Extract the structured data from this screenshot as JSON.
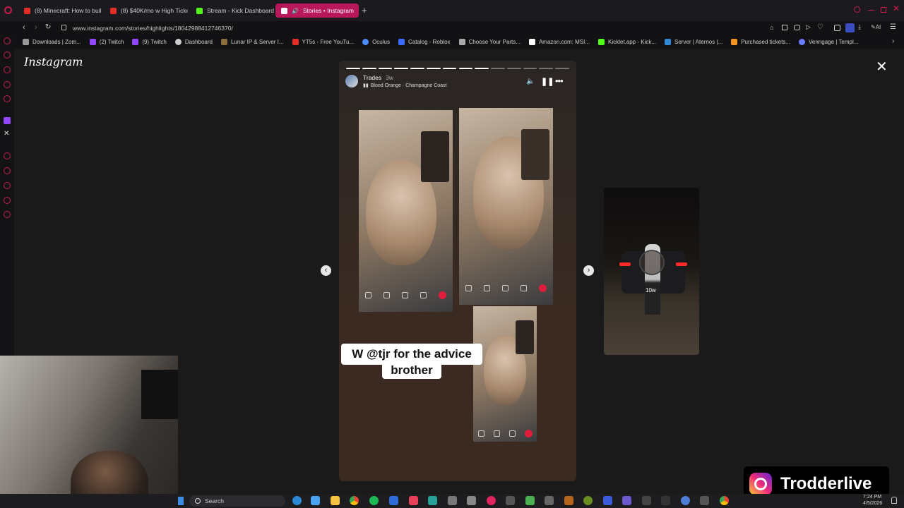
{
  "tabs": [
    {
      "label": "(8) Minecraft: How to buil...",
      "fav": "#e52d27"
    },
    {
      "label": "(8) $40K/mo w High Ticke...",
      "fav": "#e52d27"
    },
    {
      "label": "Stream - Kick Dashboard",
      "fav": "#53fc18"
    },
    {
      "label": "Stories • Instagram",
      "fav": "#e1306c"
    }
  ],
  "new_tab_label": "+",
  "url": "www.instagram.com/stories/highlights/18042988412746370/",
  "bookmarks": [
    {
      "label": "Downloads | Zom...",
      "fav": "#999"
    },
    {
      "label": "(2) Twitch",
      "fav": "#9146ff"
    },
    {
      "label": "(9) Twitch",
      "fav": "#9146ff"
    },
    {
      "label": "Dashboard",
      "fav": "#cccccc"
    },
    {
      "label": "Lunar IP & Server I...",
      "fav": "#8a6d3b"
    },
    {
      "label": "YT5s - Free YouTu...",
      "fav": "#e52d27"
    },
    {
      "label": "Oculus",
      "fav": "#4a8cff"
    },
    {
      "label": "Catalog - Roblox",
      "fav": "#3b6bff"
    },
    {
      "label": "Choose Your Parts...",
      "fav": "#aaaaaa"
    },
    {
      "label": "Amazon.com: MSI...",
      "fav": "#ffffff"
    },
    {
      "label": "Kicklet.app - Kick...",
      "fav": "#53fc18"
    },
    {
      "label": "Server | Aternos |...",
      "fav": "#2d88d8"
    },
    {
      "label": "Purchased tickets...",
      "fav": "#f7941e"
    },
    {
      "label": "Venngage | Templ...",
      "fav": "#6a7cff"
    }
  ],
  "instagram_logo": "Instagram",
  "story": {
    "username": "Trades",
    "age": "3w",
    "song": "Blood Orange · Champagne Coast",
    "caption_line1": "W @tjr  for the advice",
    "caption_line2": "brother",
    "segments_total": 14,
    "segments_done": 9
  },
  "next_story_age": "10w",
  "watermark_name": "Trodderlive",
  "taskbar": {
    "search_label": "Search",
    "time": "7:24 PM",
    "date": "4/5/2026"
  },
  "colors": {
    "accent": "#b8175a",
    "instagram": "#e1306c"
  }
}
